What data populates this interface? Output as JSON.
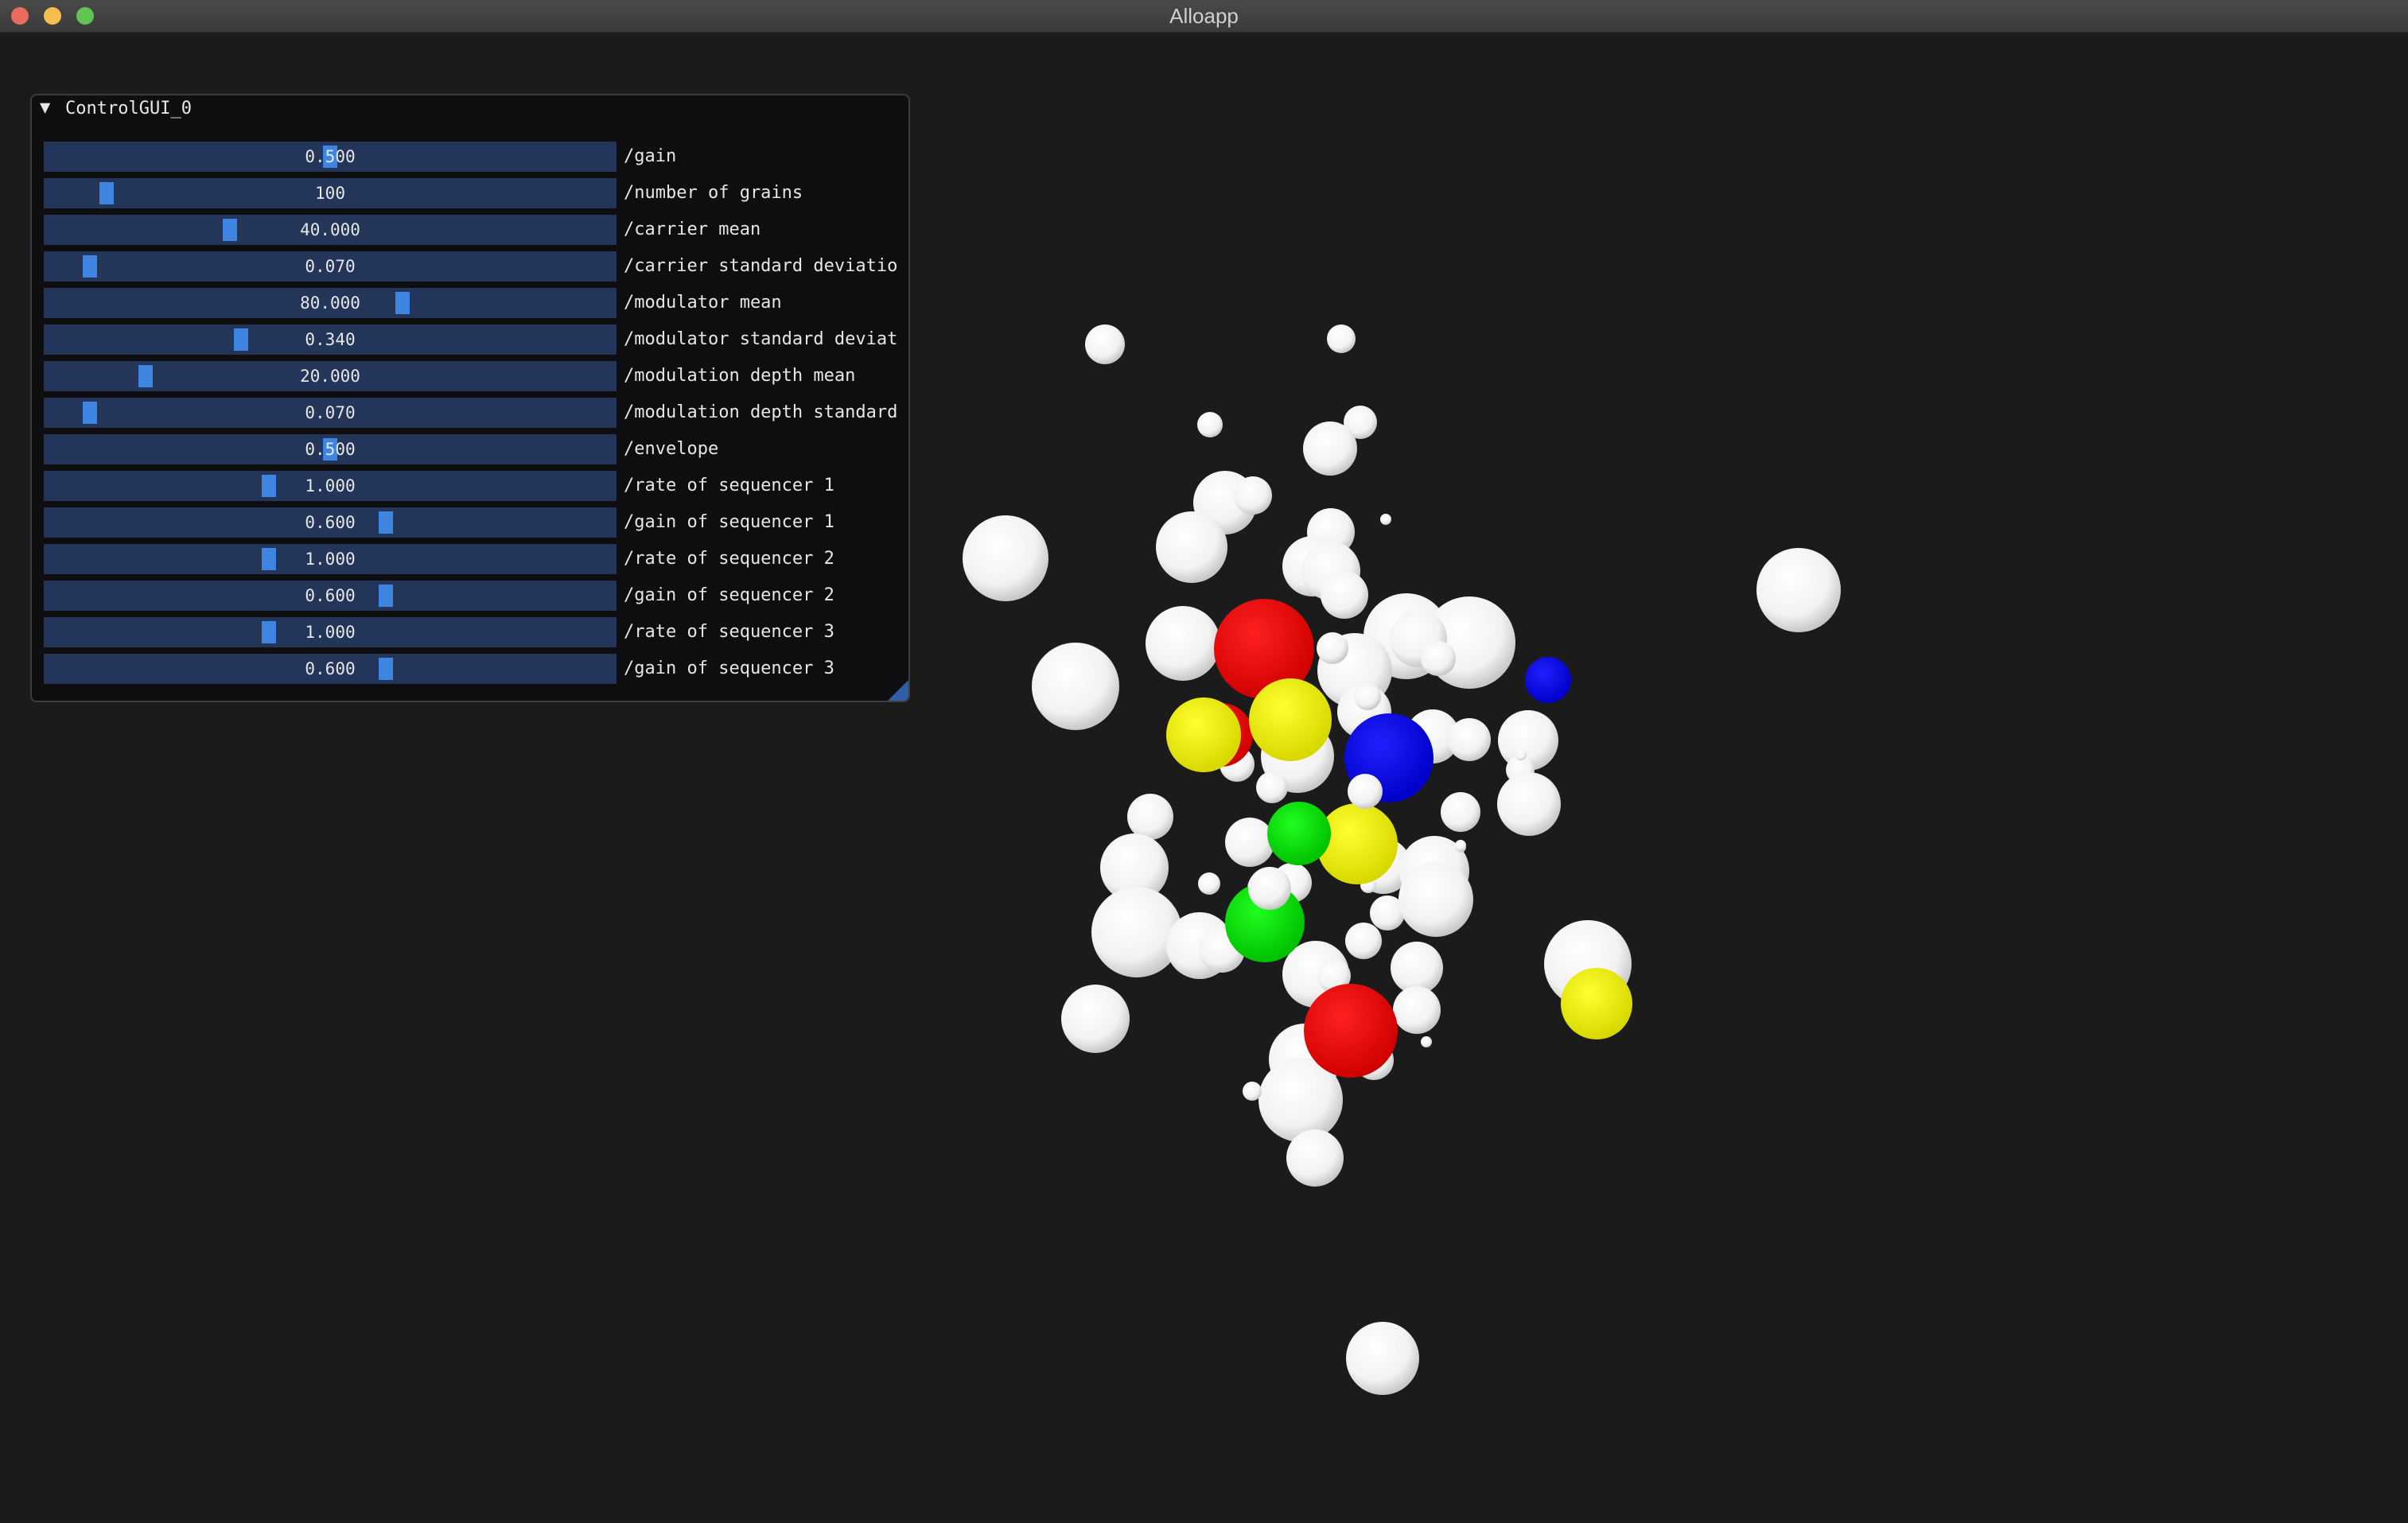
{
  "window": {
    "title": "Alloapp",
    "traffic_lights": {
      "close": "#ed6a5e",
      "minimize": "#f5bf4f",
      "maximize": "#61c554"
    }
  },
  "colors": {
    "panel_bg": "#0e0e10",
    "slider_track": "#23365a",
    "slider_grab": "#3d85e0",
    "sphere_white": "#ffffff",
    "sphere_red": "#ff0000",
    "sphere_yellow": "#ffff00",
    "sphere_green": "#00e000",
    "sphere_blue": "#0000ff"
  },
  "panel": {
    "title": "ControlGUI_0",
    "collapse_icon": "triangle-down-icon",
    "sliders": [
      {
        "value": "0.500",
        "label": "/gain",
        "fraction": 0.5
      },
      {
        "value": "100",
        "label": "/number of grains",
        "fraction": 0.1
      },
      {
        "value": "40.000",
        "label": "/carrier mean",
        "fraction": 0.32
      },
      {
        "value": "0.070",
        "label": "/carrier standard deviatio",
        "fraction": 0.07
      },
      {
        "value": "80.000",
        "label": "/modulator mean",
        "fraction": 0.63
      },
      {
        "value": "0.340",
        "label": "/modulator standard deviat",
        "fraction": 0.34
      },
      {
        "value": "20.000",
        "label": "/modulation depth mean",
        "fraction": 0.17
      },
      {
        "value": "0.070",
        "label": "/modulation depth standard",
        "fraction": 0.07
      },
      {
        "value": "0.500",
        "label": "/envelope",
        "fraction": 0.5
      },
      {
        "value": "1.000",
        "label": "/rate of sequencer 1",
        "fraction": 0.39
      },
      {
        "value": "0.600",
        "label": "/gain of sequencer 1",
        "fraction": 0.6
      },
      {
        "value": "1.000",
        "label": "/rate of sequencer 2",
        "fraction": 0.39
      },
      {
        "value": "0.600",
        "label": "/gain of sequencer 2",
        "fraction": 0.6
      },
      {
        "value": "1.000",
        "label": "/rate of sequencer 3",
        "fraction": 0.39
      },
      {
        "value": "0.600",
        "label": "/gain of sequencer 3",
        "fraction": 0.6
      }
    ]
  }
}
